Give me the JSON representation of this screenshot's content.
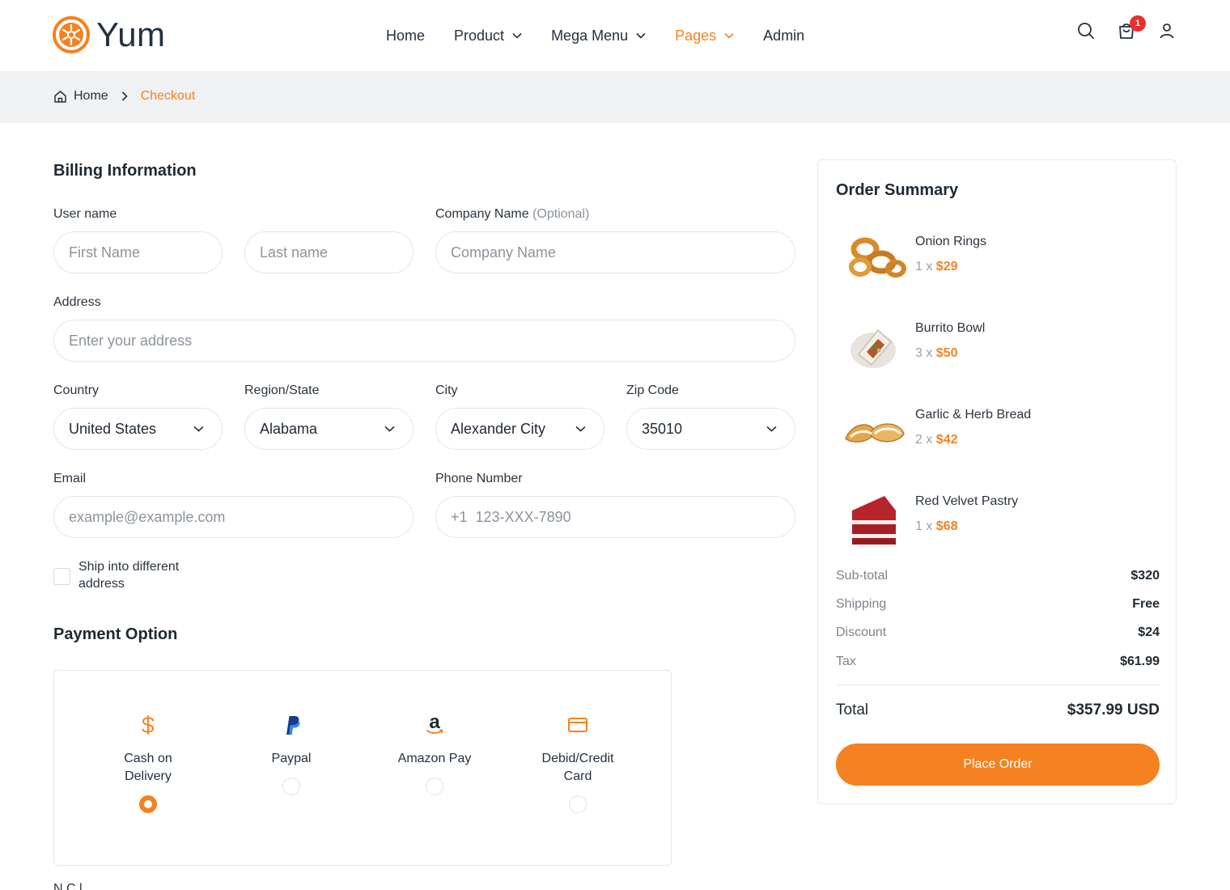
{
  "brand": {
    "name": "Yum",
    "accent": "#f48220"
  },
  "nav": [
    {
      "label": "Home",
      "has_dropdown": false,
      "active": false
    },
    {
      "label": "Product",
      "has_dropdown": true,
      "active": false
    },
    {
      "label": "Mega Menu",
      "has_dropdown": true,
      "active": false
    },
    {
      "label": "Pages",
      "has_dropdown": true,
      "active": true
    },
    {
      "label": "Admin",
      "has_dropdown": false,
      "active": false
    }
  ],
  "header_icons": {
    "search": "search-icon",
    "cart": "cart-icon",
    "user": "user-icon",
    "cart_count": "1"
  },
  "breadcrumb": {
    "home": "Home",
    "current": "Checkout"
  },
  "billing": {
    "title": "Billing Information",
    "username_label": "User name",
    "first_name_placeholder": "First Name",
    "last_name_placeholder": "Last name",
    "company_label": "Company Name",
    "company_optional": "(Optional)",
    "company_placeholder": "Company Name",
    "address_label": "Address",
    "address_placeholder": "Enter your address",
    "country_label": "Country",
    "country_value": "United States",
    "region_label": "Region/State",
    "region_value": "Alabama",
    "city_label": "City",
    "city_value": "Alexander City",
    "zip_label": "Zip Code",
    "zip_value": "35010",
    "email_label": "Email",
    "email_placeholder": "example@example.com",
    "phone_label": "Phone Number",
    "phone_placeholder": "+1  123-XXX-7890",
    "ship_different_label": "Ship into different address"
  },
  "payment": {
    "title": "Payment Option",
    "options": [
      {
        "label": "Cash on Delivery",
        "icon": "dollar-icon",
        "selected": true
      },
      {
        "label": "Paypal",
        "icon": "paypal-icon",
        "selected": false
      },
      {
        "label": "Amazon Pay",
        "icon": "amazon-icon",
        "selected": false
      },
      {
        "label": "Debid/Credit Card",
        "icon": "credit-card-icon",
        "selected": false
      }
    ],
    "next_label_partial": "N         C   l"
  },
  "summary": {
    "title": "Order Summary",
    "items": [
      {
        "name": "Onion Rings",
        "qty": "1",
        "price": "$29"
      },
      {
        "name": "Burrito Bowl",
        "qty": "3",
        "price": "$50"
      },
      {
        "name": "Garlic & Herb Bread",
        "qty": "2",
        "price": "$42"
      },
      {
        "name": "Red Velvet Pastry",
        "qty": "1",
        "price": "$68"
      }
    ],
    "subtotal_label": "Sub-total",
    "subtotal": "$320",
    "shipping_label": "Shipping",
    "shipping": "Free",
    "discount_label": "Discount",
    "discount": "$24",
    "tax_label": "Tax",
    "tax": "$61.99",
    "total_label": "Total",
    "total": "$357.99 USD",
    "place_order": "Place Order"
  }
}
